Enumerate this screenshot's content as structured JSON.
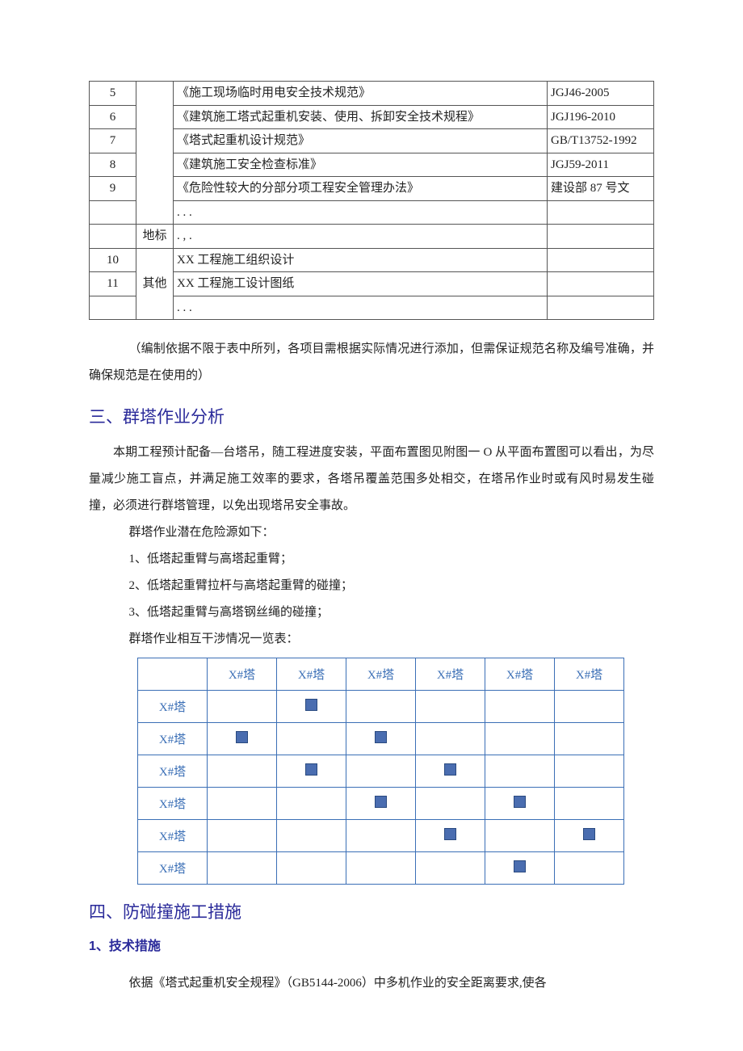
{
  "table1": {
    "rows": [
      {
        "idx": "5",
        "cat": "",
        "name": "《施工现场临时用电安全技术规范》",
        "code": "JGJ46-2005"
      },
      {
        "idx": "6",
        "cat": "",
        "name": "《建筑施工塔式起重机安装、使用、拆卸安全技术规程》",
        "code": "JGJ196-2010"
      },
      {
        "idx": "7",
        "cat": "",
        "name": "《塔式起重机设计规范》",
        "code": "GB/T13752-1992"
      },
      {
        "idx": "8",
        "cat": "",
        "name": "《建筑施工安全检查标准》",
        "code": "JGJ59-2011"
      },
      {
        "idx": "9",
        "cat": "",
        "name": "《危险性较大的分部分项工程安全管理办法》",
        "code": "建设部 87 号文"
      },
      {
        "idx": "",
        "cat": "",
        "name": ". . .",
        "code": ""
      },
      {
        "idx": "",
        "cat": "地标",
        "name": ". , .",
        "code": ""
      },
      {
        "idx": "10",
        "cat": "",
        "name": "XX 工程施工组织设计",
        "code": ""
      },
      {
        "idx": "11",
        "cat": "其他",
        "name": "XX 工程施工设计图纸",
        "code": ""
      },
      {
        "idx": "",
        "cat": "",
        "name": ". . .",
        "code": ""
      }
    ]
  },
  "note1": "（编制依据不限于表中所列，各项目需根据实际情况进行添加，但需保证规范名称及编号准确，并确保规范是在使用的）",
  "section3_title": "三、群塔作业分析",
  "section3_para": "本期工程预计配备—台塔吊，随工程进度安装，平面布置图见附图一 O 从平面布置图可以看出，为尽量减少施工盲点，并满足施工效率的要求，各塔吊覆盖范围多处相交，在塔吊作业时或有风时易发生碰撞，必须进行群塔管理，以免出现塔吊安全事故。",
  "hazard_intro": "群塔作业潜在危险源如下：",
  "hazard_1": "1、低塔起重臂与高塔起重臂；",
  "hazard_2": "2、低塔起重臂拉杆与高塔起重臂的碰撞；",
  "hazard_3": "3、低塔起重臂与高塔钢丝绳的碰撞；",
  "matrix_intro": "群塔作业相互干涉情况一览表：",
  "matrix": {
    "col_header": "X#塔",
    "row_header": "X#塔",
    "cells": [
      [
        0,
        1,
        0,
        0,
        0,
        0
      ],
      [
        1,
        0,
        1,
        0,
        0,
        0
      ],
      [
        0,
        1,
        0,
        1,
        0,
        0
      ],
      [
        0,
        0,
        1,
        0,
        1,
        0
      ],
      [
        0,
        0,
        0,
        1,
        0,
        1
      ],
      [
        0,
        0,
        0,
        0,
        1,
        0
      ]
    ]
  },
  "section4_title": "四、防碰撞施工措施",
  "sub1_title": "1、技术措施",
  "sub1_para": "依据《塔式起重机安全规程》（GB5144-2006）中多机作业的安全距离要求,使各"
}
